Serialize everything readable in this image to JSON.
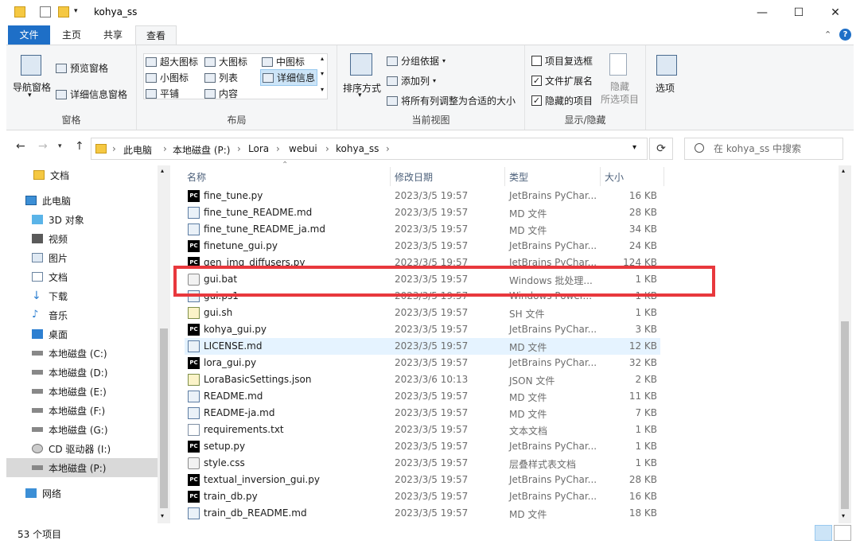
{
  "window": {
    "title": "kohya_ss",
    "minimize": "—",
    "maximize": "☐",
    "close": "✕"
  },
  "ribbon_tabs": [
    "文件",
    "主页",
    "共享",
    "查看"
  ],
  "ribbon": {
    "pane_group": {
      "nav_pane": "导航窗格",
      "preview_pane": "预览窗格",
      "details_pane": "详细信息窗格",
      "label": "窗格"
    },
    "layout_group": {
      "items": [
        "超大图标",
        "大图标",
        "中图标",
        "小图标",
        "列表",
        "详细信息",
        "平铺",
        "内容"
      ],
      "selected": "详细信息",
      "label": "布局"
    },
    "current_view_group": {
      "sort_by": "排序方式",
      "group_by": "分组依据",
      "add_columns": "添加列",
      "size_all_columns": "将所有列调整为合适的大小",
      "label": "当前视图"
    },
    "show_hide_group": {
      "item_checkboxes": {
        "label": "项目复选框",
        "checked": false
      },
      "file_extensions": {
        "label": "文件扩展名",
        "checked": true
      },
      "hidden_items": {
        "label": "隐藏的项目",
        "checked": true
      },
      "hide_selected": "隐藏\n所选项目",
      "hide_line1": "隐藏",
      "hide_line2": "所选项目",
      "label": "显示/隐藏"
    },
    "options": "选项"
  },
  "address": {
    "crumbs": [
      "此电脑",
      "本地磁盘 (P:)",
      "Lora",
      "webui",
      "kohya_ss"
    ],
    "search_placeholder": "在 kohya_ss 中搜索"
  },
  "nav_pane": {
    "items": [
      {
        "label": "文档",
        "icon": "folder-icon"
      },
      {
        "label": "此电脑",
        "icon": "computer-icon"
      },
      {
        "label": "3D 对象",
        "icon": "cube-icon"
      },
      {
        "label": "视频",
        "icon": "video-icon"
      },
      {
        "label": "图片",
        "icon": "picture-icon"
      },
      {
        "label": "文档",
        "icon": "document-icon"
      },
      {
        "label": "下载",
        "icon": "download-icon"
      },
      {
        "label": "音乐",
        "icon": "music-icon"
      },
      {
        "label": "桌面",
        "icon": "desktop-icon"
      },
      {
        "label": "本地磁盘 (C:)",
        "icon": "drive-icon"
      },
      {
        "label": "本地磁盘 (D:)",
        "icon": "drive-icon"
      },
      {
        "label": "本地磁盘 (E:)",
        "icon": "drive-icon"
      },
      {
        "label": "本地磁盘 (F:)",
        "icon": "drive-icon"
      },
      {
        "label": "本地磁盘 (G:)",
        "icon": "drive-icon"
      },
      {
        "label": "CD 驱动器 (I:)",
        "icon": "cd-drive-icon"
      },
      {
        "label": "本地磁盘 (P:)",
        "icon": "drive-icon"
      },
      {
        "label": "网络",
        "icon": "network-icon"
      }
    ],
    "selected": "本地磁盘 (P:)"
  },
  "columns": {
    "name": "名称",
    "date": "修改日期",
    "type": "类型",
    "size": "大小"
  },
  "files": [
    {
      "name": "fine_tune.py",
      "date": "2023/3/5 19:57",
      "type": "JetBrains PyChar...",
      "size": "16 KB",
      "icon": "pycharm-icon"
    },
    {
      "name": "fine_tune_README.md",
      "date": "2023/3/5 19:57",
      "type": "MD 文件",
      "size": "28 KB",
      "icon": "md-file-icon"
    },
    {
      "name": "fine_tune_README_ja.md",
      "date": "2023/3/5 19:57",
      "type": "MD 文件",
      "size": "34 KB",
      "icon": "md-file-icon"
    },
    {
      "name": "finetune_gui.py",
      "date": "2023/3/5 19:57",
      "type": "JetBrains PyChar...",
      "size": "24 KB",
      "icon": "pycharm-icon"
    },
    {
      "name": "gen_img_diffusers.py",
      "date": "2023/3/5 19:57",
      "type": "JetBrains PyChar...",
      "size": "124 KB",
      "icon": "pycharm-icon"
    },
    {
      "name": "gui.bat",
      "date": "2023/3/5 19:57",
      "type": "Windows 批处理...",
      "size": "1 KB",
      "icon": "batch-file-icon"
    },
    {
      "name": "gui.ps1",
      "date": "2023/3/5 19:57",
      "type": "Windows Power...",
      "size": "1 KB",
      "icon": "powershell-icon"
    },
    {
      "name": "gui.sh",
      "date": "2023/3/5 19:57",
      "type": "SH 文件",
      "size": "1 KB",
      "icon": "shell-file-icon"
    },
    {
      "name": "kohya_gui.py",
      "date": "2023/3/5 19:57",
      "type": "JetBrains PyChar...",
      "size": "3 KB",
      "icon": "pycharm-icon"
    },
    {
      "name": "LICENSE.md",
      "date": "2023/3/5 19:57",
      "type": "MD 文件",
      "size": "12 KB",
      "icon": "md-file-icon"
    },
    {
      "name": "lora_gui.py",
      "date": "2023/3/5 19:57",
      "type": "JetBrains PyChar...",
      "size": "32 KB",
      "icon": "pycharm-icon"
    },
    {
      "name": "LoraBasicSettings.json",
      "date": "2023/3/6 10:13",
      "type": "JSON 文件",
      "size": "2 KB",
      "icon": "json-file-icon"
    },
    {
      "name": "README.md",
      "date": "2023/3/5 19:57",
      "type": "MD 文件",
      "size": "11 KB",
      "icon": "md-file-icon"
    },
    {
      "name": "README-ja.md",
      "date": "2023/3/5 19:57",
      "type": "MD 文件",
      "size": "7 KB",
      "icon": "md-file-icon"
    },
    {
      "name": "requirements.txt",
      "date": "2023/3/5 19:57",
      "type": "文本文档",
      "size": "1 KB",
      "icon": "text-file-icon"
    },
    {
      "name": "setup.py",
      "date": "2023/3/5 19:57",
      "type": "JetBrains PyChar...",
      "size": "1 KB",
      "icon": "pycharm-icon"
    },
    {
      "name": "style.css",
      "date": "2023/3/5 19:57",
      "type": "层叠样式表文档",
      "size": "1 KB",
      "icon": "css-file-icon"
    },
    {
      "name": "textual_inversion_gui.py",
      "date": "2023/3/5 19:57",
      "type": "JetBrains PyChar...",
      "size": "28 KB",
      "icon": "pycharm-icon"
    },
    {
      "name": "train_db.py",
      "date": "2023/3/5 19:57",
      "type": "JetBrains PyChar...",
      "size": "16 KB",
      "icon": "pycharm-icon"
    },
    {
      "name": "train_db_README.md",
      "date": "2023/3/5 19:57",
      "type": "MD 文件",
      "size": "18 KB",
      "icon": "md-file-icon"
    }
  ],
  "hovered_file": "LICENSE.md",
  "highlighted_file": "gui.bat",
  "highlight_color": "#e8383d",
  "status": {
    "item_count": "53 个项目"
  }
}
